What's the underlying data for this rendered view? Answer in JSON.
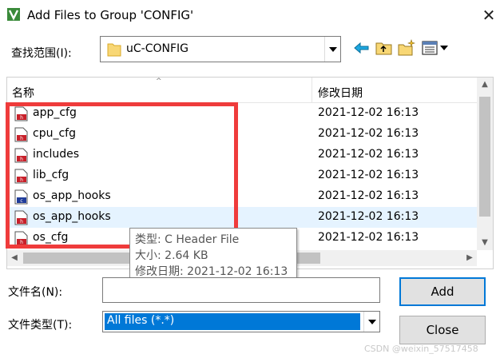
{
  "window": {
    "title": "Add Files to Group 'CONFIG'",
    "close_glyph": "✕"
  },
  "lookin": {
    "label": "查找范围(I):",
    "value": "uC-CONFIG"
  },
  "list": {
    "col_name": "名称",
    "col_date": "修改日期",
    "sort_glyph": "^",
    "files": [
      {
        "name": "app_cfg",
        "date": "2021-12-02 16:13",
        "icon": "h-file-icon"
      },
      {
        "name": "cpu_cfg",
        "date": "2021-12-02 16:13",
        "icon": "h-file-icon"
      },
      {
        "name": "includes",
        "date": "2021-12-02 16:13",
        "icon": "h-file-icon"
      },
      {
        "name": "lib_cfg",
        "date": "2021-12-02 16:13",
        "icon": "h-file-icon"
      },
      {
        "name": "os_app_hooks",
        "date": "2021-12-02 16:13",
        "icon": "c-file-icon"
      },
      {
        "name": "os_app_hooks",
        "date": "2021-12-02 16:13",
        "icon": "h-file-icon"
      },
      {
        "name": "os_cfg",
        "date": "2021-12-02 16:13",
        "icon": "h-file-icon"
      }
    ]
  },
  "tooltip": {
    "type": "类型: C Header File",
    "size": "大小: 2.64 KB",
    "modified": "修改日期: 2021-12-02 16:13"
  },
  "form": {
    "filename_label": "文件名(N):",
    "filename_value": "",
    "filetype_label": "文件类型(T):",
    "filetype_value": "All files (*.*)"
  },
  "buttons": {
    "add": "Add",
    "close": "Close"
  },
  "watermark": "CSDN @weixin_57517458",
  "colors": {
    "highlight": "#ef3b3b",
    "selection": "#0078d7",
    "hover_row": "#e5f3ff"
  }
}
